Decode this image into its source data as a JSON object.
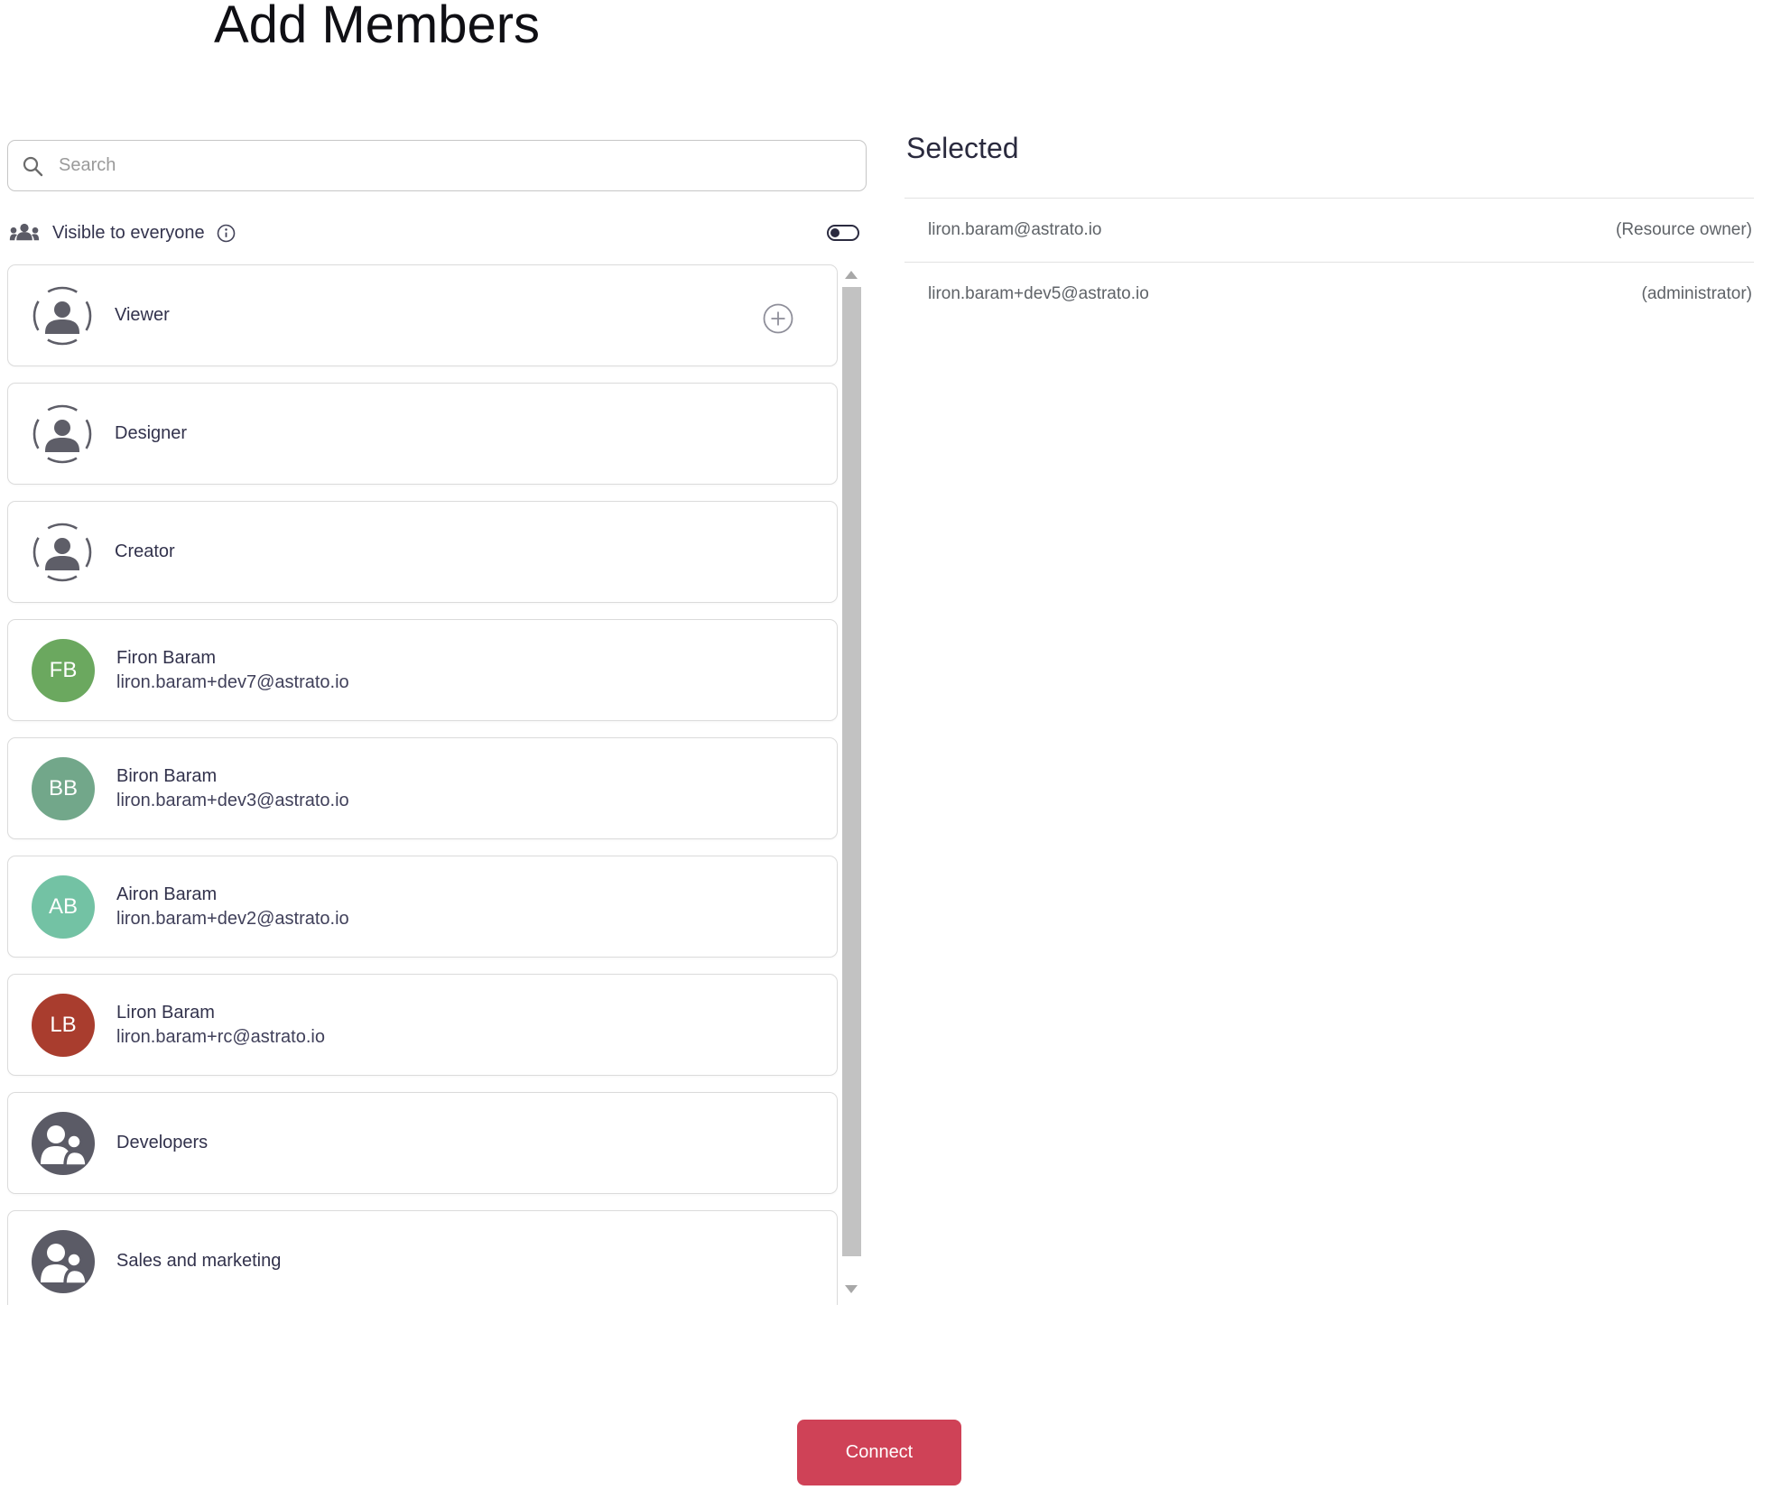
{
  "title": "Add Members",
  "search": {
    "placeholder": "Search"
  },
  "visibility": {
    "label": "Visible to everyone",
    "toggle_on": false
  },
  "list": {
    "items": [
      {
        "type": "role",
        "label": "Viewer",
        "has_add_button": true
      },
      {
        "type": "role",
        "label": "Designer"
      },
      {
        "type": "role",
        "label": "Creator"
      },
      {
        "type": "user",
        "initials": "FB",
        "name": "Firon Baram",
        "email": "liron.baram+dev7@astrato.io",
        "avatar_color": "#6BA85F"
      },
      {
        "type": "user",
        "initials": "BB",
        "name": "Biron Baram",
        "email": "liron.baram+dev3@astrato.io",
        "avatar_color": "#72A78A"
      },
      {
        "type": "user",
        "initials": "AB",
        "name": "Airon Baram",
        "email": "liron.baram+dev2@astrato.io",
        "avatar_color": "#73C2A4"
      },
      {
        "type": "user",
        "initials": "LB",
        "name": "Liron Baram",
        "email": "liron.baram+rc@astrato.io",
        "avatar_color": "#A93D2E"
      },
      {
        "type": "group",
        "label": "Developers"
      },
      {
        "type": "group",
        "label": "Sales and marketing"
      }
    ]
  },
  "selected_panel": {
    "heading": "Selected",
    "rows": [
      {
        "email": "liron.baram@astrato.io",
        "role": "(Resource owner)"
      },
      {
        "email": "liron.baram+dev5@astrato.io",
        "role": "(administrator)"
      }
    ]
  },
  "footer": {
    "connect_label": "Connect"
  },
  "colors": {
    "connect_button": "#CF4257",
    "toggle": "#2B2B40",
    "card_border": "#DBDBDB",
    "divider": "#E2E2E2",
    "muted_text": "#5F6368",
    "dark_text": "#32324C",
    "scrollbar_thumb": "#C2C2C2",
    "avatar_fb": "#6BA85F",
    "avatar_bb": "#72A78A",
    "avatar_ab": "#73C2A4",
    "avatar_lb": "#A93D2E"
  }
}
